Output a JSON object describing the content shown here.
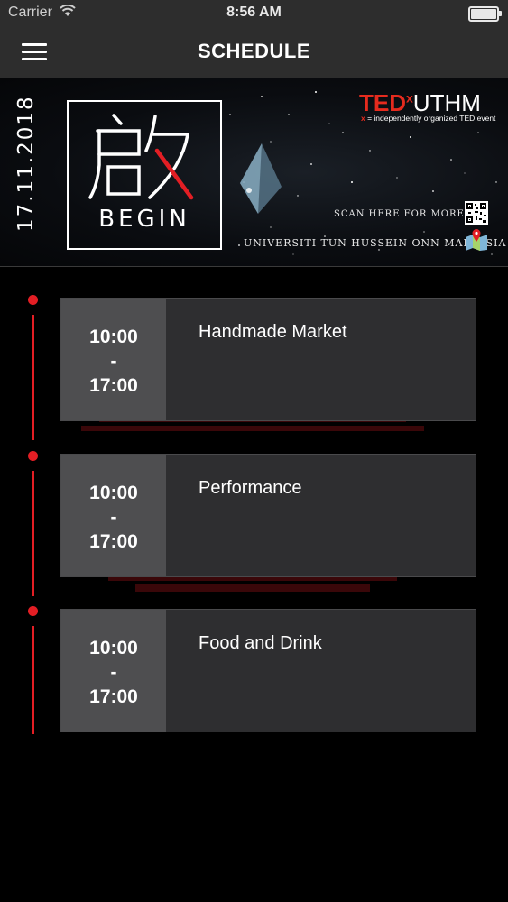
{
  "status_bar": {
    "carrier": "Carrier",
    "time": "8:56 AM"
  },
  "nav": {
    "title": "SCHEDULE",
    "menu_icon": "hamburger-menu-icon"
  },
  "banner": {
    "date": "17.11.2018",
    "logo_word": "BEGIN",
    "ted_brand": "TED",
    "ted_x": "x",
    "ted_event": "UTHM",
    "tagline_x": "x",
    "tagline": " = independently organized TED event",
    "scan_text": "SCAN HERE FOR MORE !",
    "university": "UNIVERSITI TUN HUSSEIN ONN MALAYSIA"
  },
  "colors": {
    "accent": "#e31e24",
    "ted_red": "#e62b1e",
    "bar": "#2d2d2d",
    "card": "#2e2e30",
    "time_box": "#4e4e50"
  },
  "schedule": {
    "events": [
      {
        "start": "10:00",
        "separator": "-",
        "end": "17:00",
        "title": "Handmade Market"
      },
      {
        "start": "10:00",
        "separator": "-",
        "end": "17:00",
        "title": "Performance"
      },
      {
        "start": "10:00",
        "separator": "-",
        "end": "17:00",
        "title": "Food and Drink"
      }
    ]
  }
}
